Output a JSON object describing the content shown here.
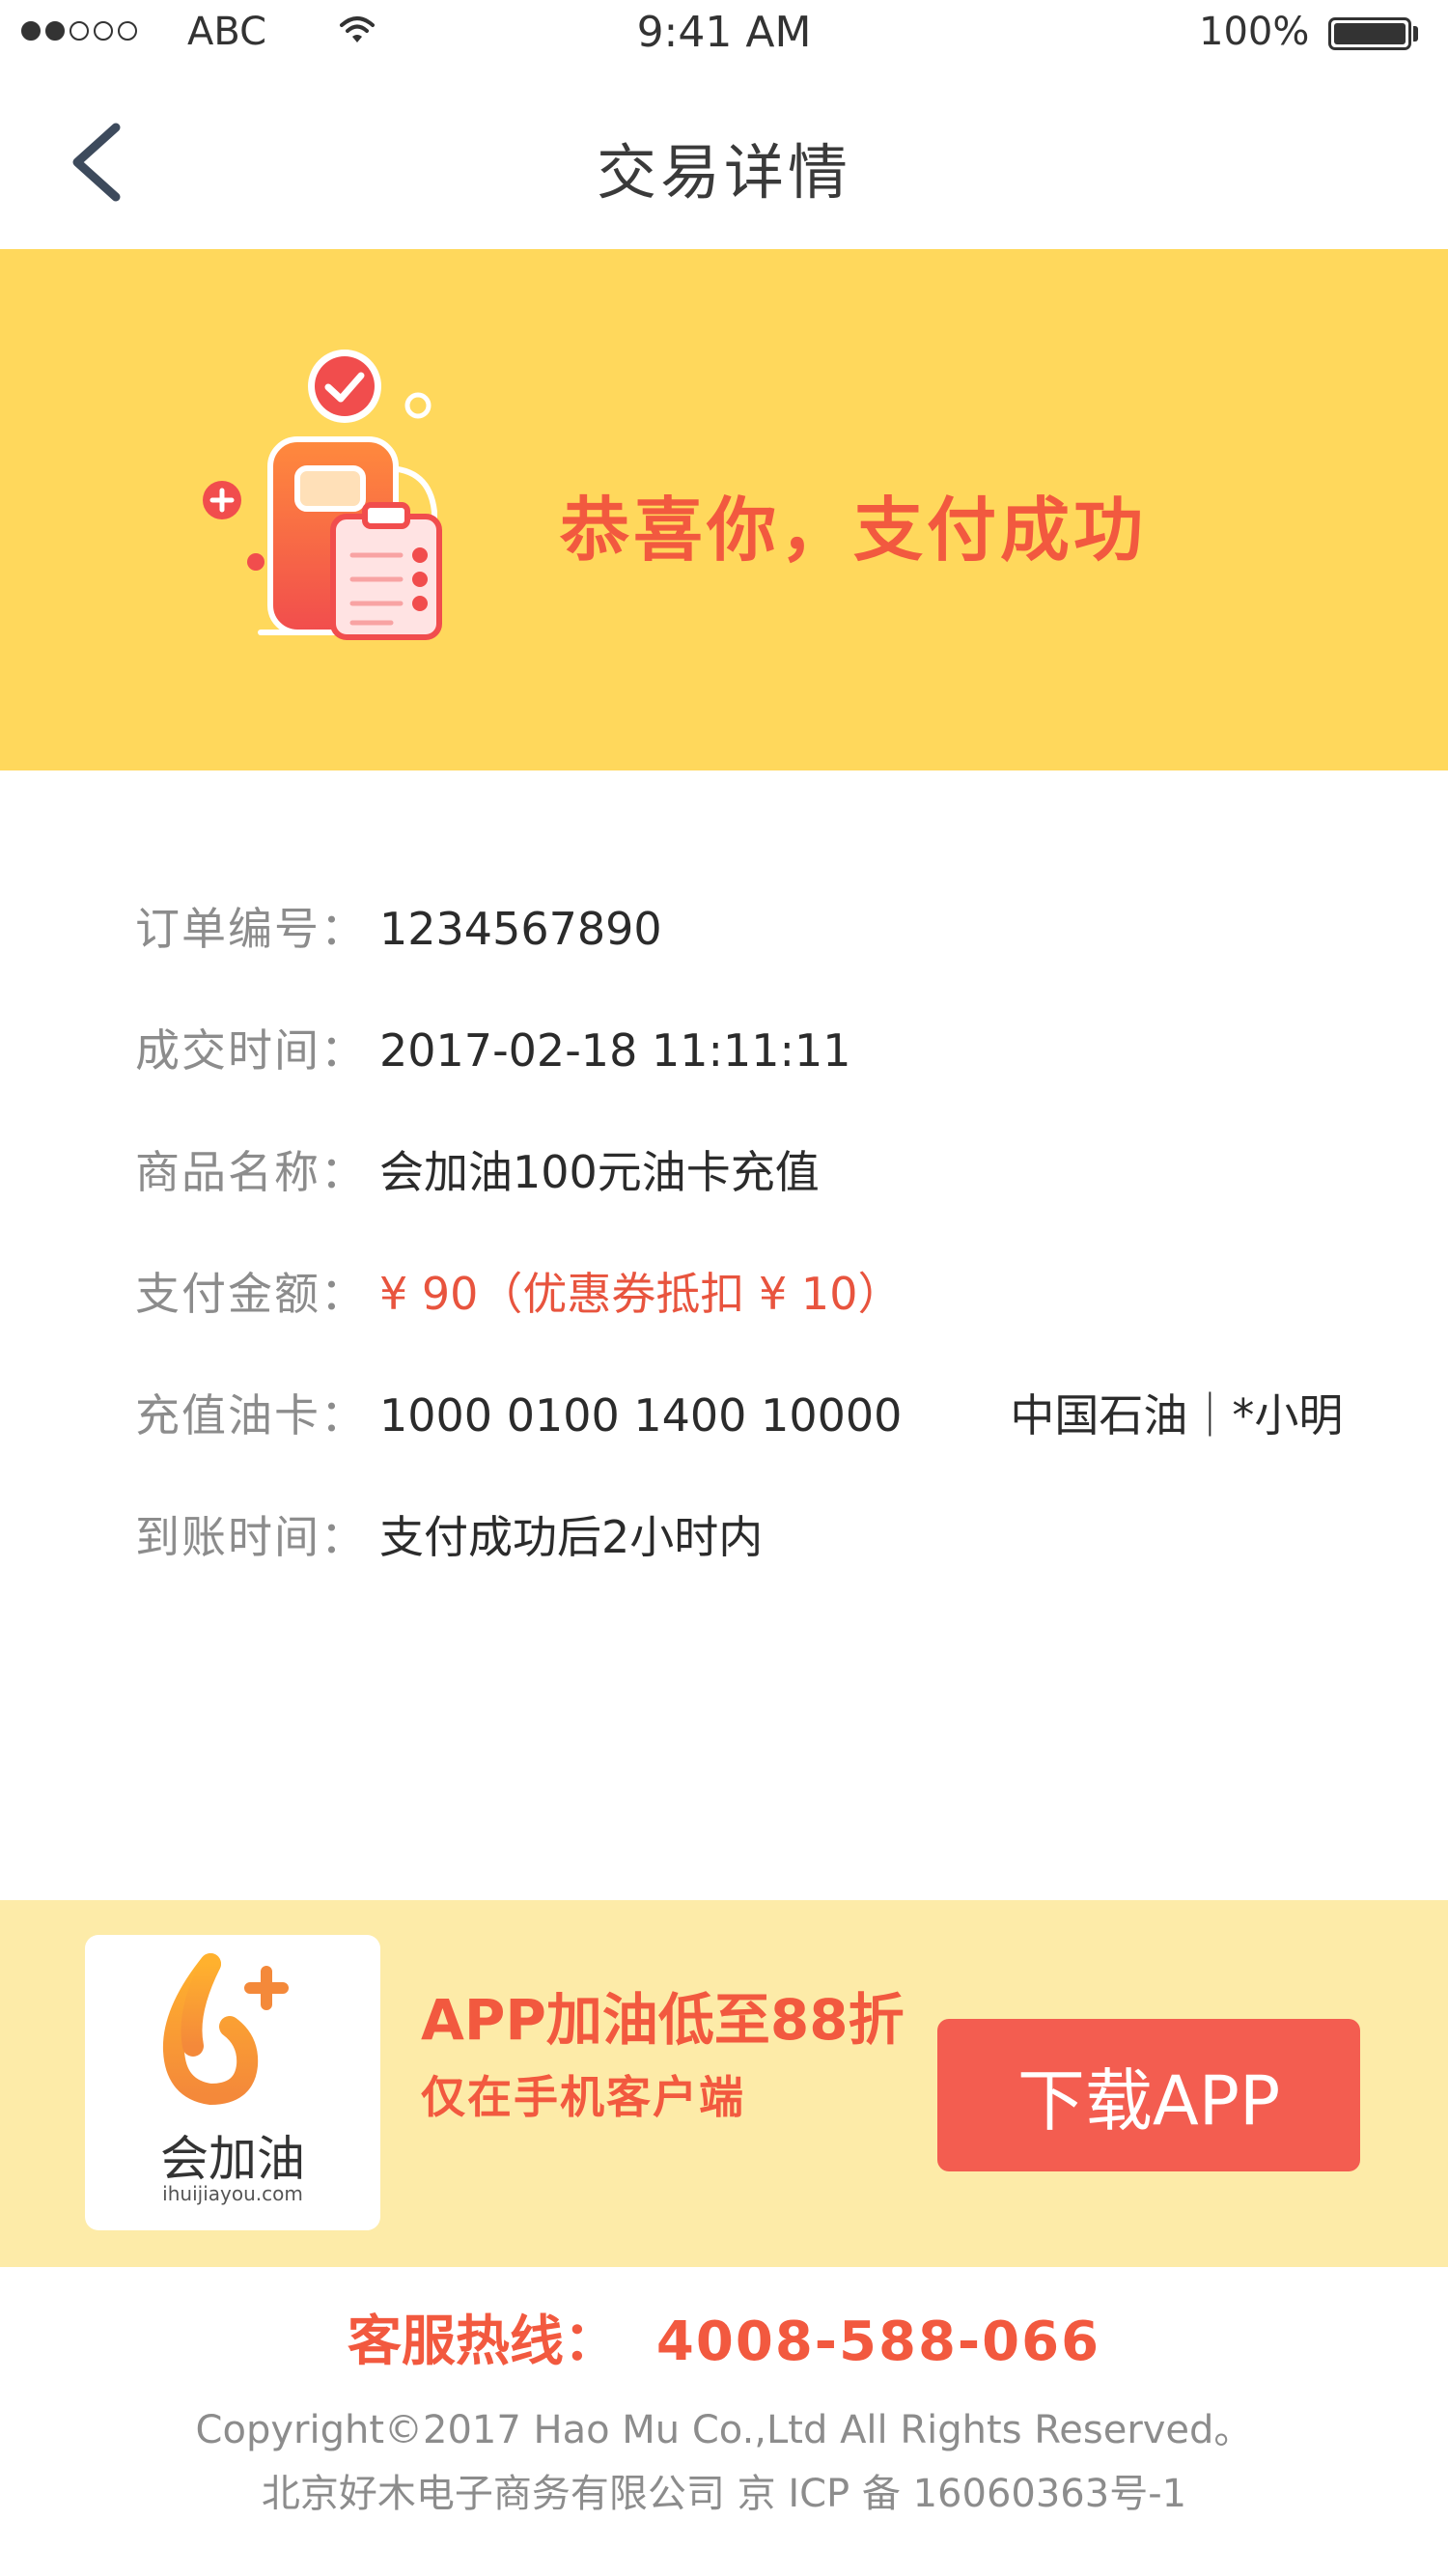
{
  "status_bar": {
    "carrier": "ABC",
    "time": "9:41 AM",
    "battery": "100%"
  },
  "nav": {
    "title": "交易详情"
  },
  "banner": {
    "message": "恭喜你，支付成功"
  },
  "details": {
    "order_no": {
      "label": "订单编号：",
      "value": "1234567890"
    },
    "deal_time": {
      "label": "成交时间：",
      "value": "2017-02-18 11:11:11"
    },
    "product": {
      "label": "商品名称：",
      "value": "会加油100元油卡充值"
    },
    "amount": {
      "label": "支付金额：",
      "value": "¥ 90（优惠券抵扣 ¥ 10）"
    },
    "card": {
      "label": "充值油卡：",
      "value": "1000 0100 1400 10000",
      "extra": "中国石油｜*小明"
    },
    "arrival": {
      "label": "到账时间：",
      "value": "支付成功后2小时内"
    }
  },
  "promo": {
    "logo_text": "会加油",
    "logo_url": "ihuijiayou.com",
    "title": "APP加油低至88折",
    "subtitle": "仅在手机客户端",
    "button": "下载APP"
  },
  "footer": {
    "hotline_label": "客服热线：",
    "hotline_number": "4008-588-066",
    "copyright": "Copyright©2017 Hao Mu Co.,Ltd All Rights Reserved。",
    "icp": "北京好木电子商务有限公司 京 ICP 备 16060363号-1"
  },
  "colors": {
    "banner": "#FFD85C",
    "promo_bg": "#FDEBA8",
    "accent": "#F2593F",
    "button": "#F35D50"
  }
}
